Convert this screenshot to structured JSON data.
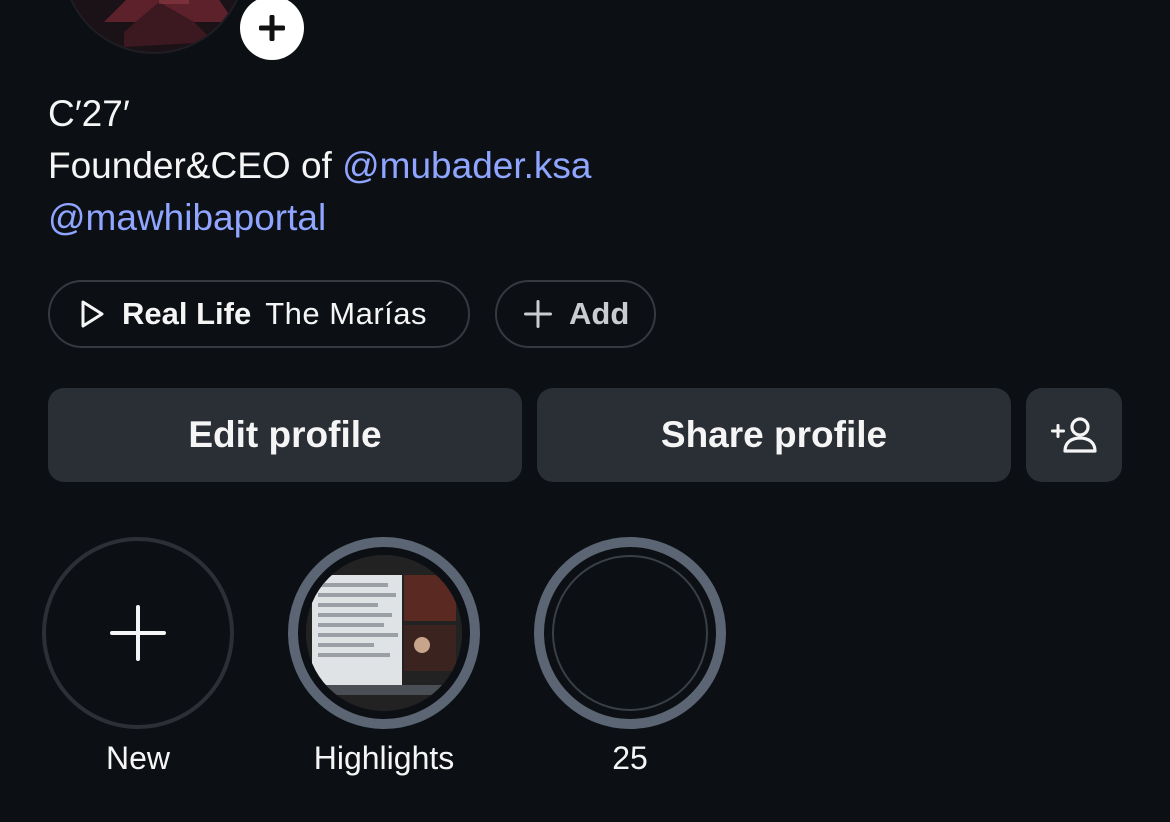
{
  "profile": {
    "avatar_icon": "avatar",
    "add_story_icon": "plus-icon"
  },
  "bio": {
    "line1": "C′27′",
    "line2_prefix": "Founder&CEO of ",
    "mention1": "@mubader.ksa",
    "mention2": "@mawhibaportal",
    "link_color": "#8fa5ff"
  },
  "music_chip": {
    "icon": "play-icon",
    "title": "Real Life",
    "artist": "The Marías"
  },
  "add_chip": {
    "icon": "plus-icon",
    "label": "Add"
  },
  "actions": {
    "edit_label": "Edit profile",
    "share_label": "Share profile",
    "add_user_icon": "add-person-icon"
  },
  "highlights": [
    {
      "label": "New",
      "icon": "plus-icon"
    },
    {
      "label": "Highlights"
    },
    {
      "label": "25"
    }
  ],
  "colors": {
    "background": "#0c1014",
    "button_bg": "#2a2e35",
    "highlight_ring": "#5b6573"
  }
}
